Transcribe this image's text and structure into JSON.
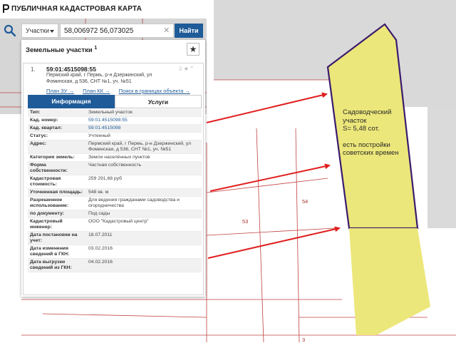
{
  "app": {
    "title": "ПУБЛИЧНАЯ КАДАСТРОВАЯ КАРТА"
  },
  "search": {
    "type_label": "Участки",
    "query": "58,006972 56,073025",
    "find_label": "Найти"
  },
  "panel": {
    "title": "Земельные участки",
    "title_sup": "1",
    "result": {
      "index": "1.",
      "cad_number": "59:01:4515098:55",
      "address": "Пермский край, г Пермь, р-н Дзержинский, ул Фоминская, д 536, СНТ №1, уч. №51",
      "links": [
        "План ЗУ →",
        "План КК →",
        "Поиск в границах объекта →"
      ]
    },
    "tabs": {
      "info": "Информация",
      "services": "Услуги"
    },
    "properties": [
      {
        "key": "Тип:",
        "value": "Земельный участок"
      },
      {
        "key": "Кад. номер:",
        "value": "59:01:4515098:55"
      },
      {
        "key": "Кад. квартал:",
        "value": "59:01:4515098"
      },
      {
        "key": "Статус:",
        "value": "Учтенный"
      },
      {
        "key": "Адрес:",
        "value": "Пермский край, г Пермь, р-н Дзержинский, ул Фоминская, д 536, СНТ №1, уч. №51"
      },
      {
        "key": "Категория земель:",
        "value": "Земли населённых пунктов"
      },
      {
        "key": "Форма собственности:",
        "value": "Частная собственность"
      },
      {
        "key": "Кадастровая стоимость:",
        "value": "259 291,68 руб"
      },
      {
        "key": "Уточненная площадь:",
        "value": "548 кв. м"
      },
      {
        "key": "Разрешенное использование:",
        "value": "Для ведения гражданами садоводства и огородничества"
      },
      {
        "key": "по документу:",
        "value": "Под сады"
      },
      {
        "key": "Кадастровый инженер:",
        "value": "ООО \"Кадастровый центр\""
      },
      {
        "key": "Дата постановки на учет:",
        "value": "18.07.2011"
      },
      {
        "key": "Дата изменения сведений в ГКН:",
        "value": "03.02.2016"
      },
      {
        "key": "Дата выгрузки сведений из ГКН:",
        "value": "04.02.2016"
      }
    ]
  },
  "map": {
    "labels": {
      "a": "54",
      "b": "53",
      "c": "3"
    },
    "annotation": {
      "line1": "Садоводческий",
      "line2": "участок",
      "line3": "S= 5,48 сот.",
      "line4": "есть постройки",
      "line5": "советских времен"
    }
  },
  "colors": {
    "accent": "#1f5b98",
    "parcel_fill": "#ece77a",
    "parcel_border": "#3a1a6e",
    "arrow": "#e02020",
    "boundary": "#c04040"
  }
}
